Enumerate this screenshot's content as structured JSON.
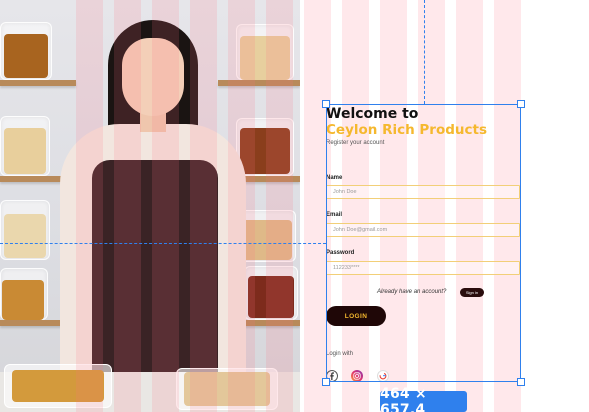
{
  "form": {
    "title": "Welcome to",
    "brand": "Ceylon Rich Products",
    "subtitle": "Register your account",
    "name_label": "Name",
    "name_placeholder": "John Doe",
    "email_label": "Email",
    "email_placeholder": "John Doe@gmail.com",
    "password_label": "Password",
    "password_placeholder": "112233****",
    "already_text": "Already have an account?",
    "signin_label": "Sign in",
    "login_label": "LOGIN",
    "login_with_text": "Login with"
  },
  "social_icons": [
    "facebook-icon",
    "instagram-icon",
    "google-icon"
  ],
  "selection": {
    "dimensions_label": "464 × 657.4"
  },
  "colors": {
    "brand_yellow": "#f5b82e",
    "button_dark": "#1f0707",
    "guide_blue": "#2f80ed",
    "grid_pink": "rgba(255,110,130,0.16)",
    "field_border": "#f2cf78"
  }
}
